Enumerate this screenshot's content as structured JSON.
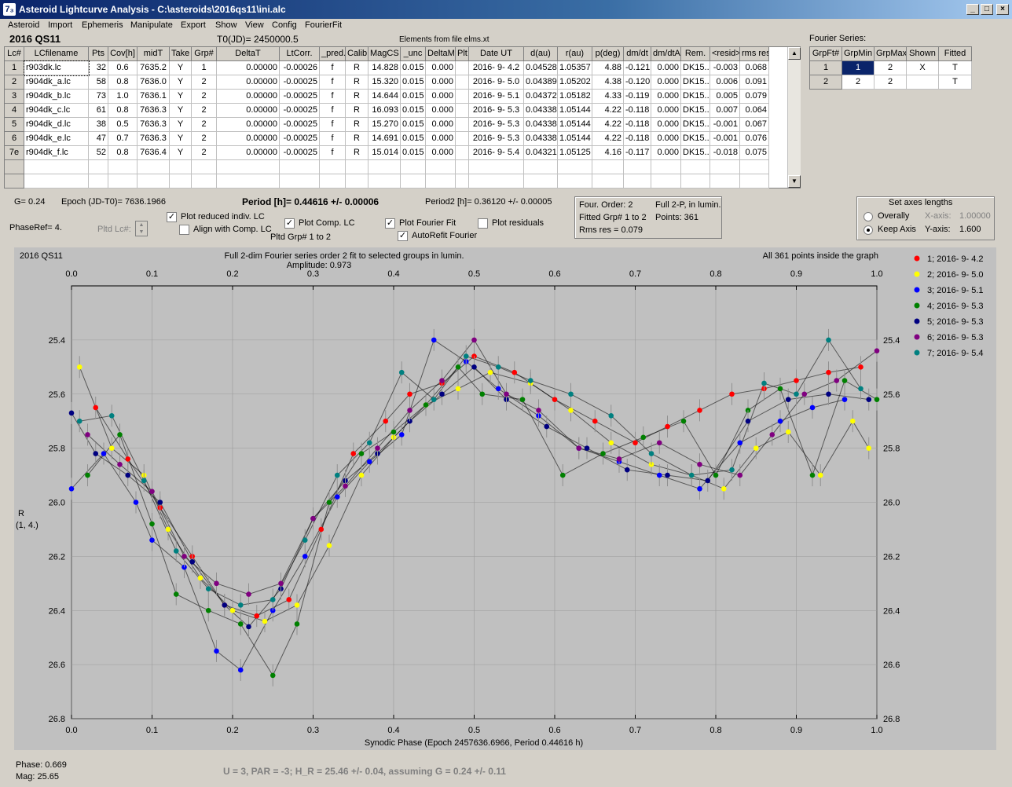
{
  "window": {
    "title": "Asteroid Lightcurve Analysis - C:\\asteroids\\2016qs11\\ini.alc",
    "app_icon": "7₃",
    "min": "_",
    "max": "□",
    "close": "×"
  },
  "menu": [
    "Asteroid",
    "Import",
    "Ephemeris",
    "Manipulate",
    "Export",
    "Show",
    "View",
    "Config",
    "FourierFit"
  ],
  "header": {
    "object": "2016 QS11",
    "t0": "T0(JD)= 2450000.5",
    "elements": "Elements from file elms.xt",
    "fourier_label": "Fourier Series:"
  },
  "lc_table": {
    "columns": [
      "Lc#",
      "LCfilename",
      "Pts",
      "Cov[h]",
      "midT",
      "Take",
      "Grp#",
      "DeltaT",
      "LtCorr.",
      "_pred.",
      "Calib.",
      "MagCS",
      "_unc",
      "DeltaM",
      "Plt",
      "Date UT",
      "d(au)",
      "r(au)",
      "p(deg)",
      "dm/dt",
      "dm/dtA",
      "Rem.",
      "<resid>",
      "rms res"
    ],
    "rows": [
      [
        "1",
        "r903dk.lc",
        "32",
        "0.6",
        "7635.2",
        "Y",
        "1",
        "0.00000",
        "-0.00026",
        "f",
        "R",
        "14.828",
        "0.015",
        "0.000",
        "",
        "2016- 9- 4.2",
        "0.04528",
        "1.05357",
        "4.88",
        "-0.121",
        "0.000",
        "DK15...",
        "-0.003",
        "0.068"
      ],
      [
        "2",
        "r904dk_a.lc",
        "58",
        "0.8",
        "7636.0",
        "Y",
        "2",
        "0.00000",
        "-0.00025",
        "f",
        "R",
        "15.320",
        "0.015",
        "0.000",
        "",
        "2016- 9- 5.0",
        "0.04389",
        "1.05202",
        "4.38",
        "-0.120",
        "0.000",
        "DK15...",
        "0.006",
        "0.091"
      ],
      [
        "3",
        "r904dk_b.lc",
        "73",
        "1.0",
        "7636.1",
        "Y",
        "2",
        "0.00000",
        "-0.00025",
        "f",
        "R",
        "14.644",
        "0.015",
        "0.000",
        "",
        "2016- 9- 5.1",
        "0.04372",
        "1.05182",
        "4.33",
        "-0.119",
        "0.000",
        "DK15...",
        "0.005",
        "0.079"
      ],
      [
        "4",
        "r904dk_c.lc",
        "61",
        "0.8",
        "7636.3",
        "Y",
        "2",
        "0.00000",
        "-0.00025",
        "f",
        "R",
        "16.093",
        "0.015",
        "0.000",
        "",
        "2016- 9- 5.3",
        "0.04338",
        "1.05144",
        "4.22",
        "-0.118",
        "0.000",
        "DK15...",
        "0.007",
        "0.064"
      ],
      [
        "5",
        "r904dk_d.lc",
        "38",
        "0.5",
        "7636.3",
        "Y",
        "2",
        "0.00000",
        "-0.00025",
        "f",
        "R",
        "15.270",
        "0.015",
        "0.000",
        "",
        "2016- 9- 5.3",
        "0.04338",
        "1.05144",
        "4.22",
        "-0.118",
        "0.000",
        "DK15...",
        "-0.001",
        "0.067"
      ],
      [
        "6",
        "r904dk_e.lc",
        "47",
        "0.7",
        "7636.3",
        "Y",
        "2",
        "0.00000",
        "-0.00025",
        "f",
        "R",
        "14.691",
        "0.015",
        "0.000",
        "",
        "2016- 9- 5.3",
        "0.04338",
        "1.05144",
        "4.22",
        "-0.118",
        "0.000",
        "DK15...",
        "-0.001",
        "0.076"
      ],
      [
        "7e",
        "r904dk_f.lc",
        "52",
        "0.8",
        "7636.4",
        "Y",
        "2",
        "0.00000",
        "-0.00025",
        "f",
        "R",
        "15.014",
        "0.015",
        "0.000",
        "",
        "2016- 9- 5.4",
        "0.04321",
        "1.05125",
        "4.16",
        "-0.117",
        "0.000",
        "DK15...",
        "-0.018",
        "0.075"
      ]
    ]
  },
  "fourier_table": {
    "columns": [
      "GrpFt#",
      "GrpMin",
      "GrpMax",
      "Shown",
      "Fitted"
    ],
    "rows": [
      [
        "1",
        "1",
        "2",
        "X",
        "T"
      ],
      [
        "2",
        "2",
        "2",
        "",
        "T"
      ]
    ]
  },
  "info": {
    "g": "G= 0.24",
    "epoch": "Epoch (JD-T0)= 7636.1966",
    "period": "Period [h]= 0.44616 +/- 0.00006",
    "period2": "Period2 [h]= 0.36120 +/- 0.00005",
    "phase_ref": "PhaseRef= 4.",
    "pltd_lc": "Pltd Lc#:",
    "plot_reduced": "Plot reduced indiv. LC",
    "align": "Align with Comp. LC",
    "plot_comp": "Plot Comp. LC",
    "pltd_grp": "Pltd Grp#  1  to  2",
    "plot_fourier": "Plot Fourier Fit",
    "autorefit": "AutoRefit Fourier",
    "plot_residuals": "Plot residuals"
  },
  "fit_box": {
    "order": "Four. Order:  2",
    "full2p": "Full 2-P, in lumin.",
    "fitted": "Fitted Grp# 1 to 2",
    "points": "Points: 361",
    "rms": "Rms res    = 0.079"
  },
  "axes_box": {
    "title": "Set axes lengths",
    "overally": "Overally",
    "keep": "Keep Axis",
    "xaxis_label": "X-axis:",
    "xaxis_val": "1.00000",
    "yaxis_label": "Y-axis:",
    "yaxis_val": "1.600"
  },
  "chart_data": {
    "type": "scatter",
    "title": "Full 2-dim Fourier series order 2 fit to selected groups in lumin.",
    "subtitle": "Amplitude: 0.973",
    "object_label": "2016 QS11",
    "points_note": "All 361 points inside the graph",
    "xlabel": "Synodic Phase (Epoch 2457636.6966, Period 0.44616 h)",
    "ylabel": "R",
    "ylabel2": "(1, 4.)",
    "xlim": [
      0.0,
      1.0
    ],
    "ylim": [
      25.2,
      26.8
    ],
    "y_inverted": true,
    "grid": true,
    "xticks": [
      "0.0",
      "0.1",
      "0.2",
      "0.3",
      "0.4",
      "0.5",
      "0.6",
      "0.7",
      "0.8",
      "0.9",
      "1.0"
    ],
    "yticks": [
      "25.4",
      "25.6",
      "25.8",
      "26.0",
      "26.2",
      "26.4",
      "26.6",
      "26.8"
    ],
    "series": [
      {
        "name": "1; 2016- 9- 4.2",
        "color": "#ff0000",
        "x": [
          0.03,
          0.07,
          0.11,
          0.15,
          0.19,
          0.23,
          0.27,
          0.31,
          0.35,
          0.39,
          0.42,
          0.46,
          0.5,
          0.55,
          0.6,
          0.65,
          0.7,
          0.74,
          0.78,
          0.82,
          0.86,
          0.9,
          0.94,
          0.98
        ],
        "y": [
          25.65,
          25.84,
          26.02,
          26.2,
          26.38,
          26.42,
          26.36,
          26.1,
          25.82,
          25.7,
          25.6,
          25.56,
          25.46,
          25.52,
          25.62,
          25.7,
          25.78,
          25.72,
          25.66,
          25.6,
          25.58,
          25.55,
          25.52,
          25.5
        ]
      },
      {
        "name": "2; 2016- 9- 5.0",
        "color": "#ffff00",
        "x": [
          0.01,
          0.05,
          0.09,
          0.12,
          0.16,
          0.2,
          0.24,
          0.28,
          0.32,
          0.36,
          0.4,
          0.44,
          0.48,
          0.52,
          0.57,
          0.62,
          0.67,
          0.72,
          0.77,
          0.81,
          0.85,
          0.89,
          0.93,
          0.97,
          0.99
        ],
        "y": [
          25.5,
          25.8,
          25.9,
          26.1,
          26.28,
          26.4,
          26.44,
          26.38,
          26.16,
          25.9,
          25.76,
          25.64,
          25.58,
          25.52,
          25.56,
          25.66,
          25.78,
          25.86,
          25.9,
          25.95,
          25.8,
          25.74,
          25.9,
          25.7,
          25.8
        ]
      },
      {
        "name": "3; 2016- 9- 5.1",
        "color": "#0000ff",
        "x": [
          0.0,
          0.04,
          0.08,
          0.1,
          0.14,
          0.18,
          0.21,
          0.25,
          0.29,
          0.33,
          0.37,
          0.41,
          0.45,
          0.49,
          0.53,
          0.58,
          0.63,
          0.68,
          0.73,
          0.78,
          0.83,
          0.88,
          0.92,
          0.96
        ],
        "y": [
          25.95,
          25.82,
          26.0,
          26.14,
          26.24,
          26.55,
          26.62,
          26.4,
          26.2,
          25.98,
          25.85,
          25.75,
          25.4,
          25.48,
          25.58,
          25.68,
          25.8,
          25.85,
          25.9,
          25.95,
          25.78,
          25.7,
          25.65,
          25.62
        ]
      },
      {
        "name": "4; 2016- 9- 5.3",
        "color": "#008000",
        "x": [
          0.02,
          0.06,
          0.1,
          0.13,
          0.17,
          0.21,
          0.25,
          0.28,
          0.32,
          0.36,
          0.4,
          0.44,
          0.48,
          0.51,
          0.56,
          0.61,
          0.66,
          0.71,
          0.76,
          0.8,
          0.84,
          0.88,
          0.92,
          0.96,
          1.0
        ],
        "y": [
          25.9,
          25.75,
          26.08,
          26.34,
          26.4,
          26.45,
          26.64,
          26.45,
          26.0,
          25.82,
          25.74,
          25.64,
          25.5,
          25.6,
          25.62,
          25.9,
          25.82,
          25.76,
          25.7,
          25.9,
          25.66,
          25.58,
          25.9,
          25.55,
          25.62
        ]
      },
      {
        "name": "5; 2016- 9- 5.3",
        "color": "#000080",
        "x": [
          0.0,
          0.03,
          0.07,
          0.11,
          0.15,
          0.19,
          0.22,
          0.26,
          0.3,
          0.34,
          0.38,
          0.42,
          0.46,
          0.5,
          0.54,
          0.59,
          0.64,
          0.69,
          0.74,
          0.79,
          0.84,
          0.89,
          0.94,
          0.99
        ],
        "y": [
          25.67,
          25.82,
          25.9,
          26.0,
          26.22,
          26.38,
          26.46,
          26.32,
          26.06,
          25.92,
          25.82,
          25.7,
          25.6,
          25.5,
          25.62,
          25.72,
          25.8,
          25.88,
          25.9,
          25.92,
          25.7,
          25.62,
          25.6,
          25.62
        ]
      },
      {
        "name": "6; 2016- 9- 5.3",
        "color": "#800080",
        "x": [
          0.02,
          0.06,
          0.1,
          0.14,
          0.18,
          0.22,
          0.26,
          0.3,
          0.34,
          0.38,
          0.42,
          0.46,
          0.5,
          0.54,
          0.58,
          0.63,
          0.68,
          0.73,
          0.78,
          0.83,
          0.87,
          0.91,
          0.95,
          1.0
        ],
        "y": [
          25.75,
          25.86,
          25.96,
          26.2,
          26.3,
          26.34,
          26.3,
          26.06,
          25.94,
          25.8,
          25.66,
          25.55,
          25.4,
          25.6,
          25.66,
          25.8,
          25.84,
          25.78,
          25.86,
          25.9,
          25.75,
          25.6,
          25.55,
          25.44
        ]
      },
      {
        "name": "7; 2016- 9- 5.4",
        "color": "#008080",
        "x": [
          0.01,
          0.05,
          0.09,
          0.13,
          0.17,
          0.21,
          0.25,
          0.29,
          0.33,
          0.37,
          0.41,
          0.45,
          0.49,
          0.53,
          0.57,
          0.62,
          0.67,
          0.72,
          0.77,
          0.82,
          0.86,
          0.9,
          0.94,
          0.98
        ],
        "y": [
          25.7,
          25.68,
          25.92,
          26.18,
          26.32,
          26.38,
          26.36,
          26.14,
          25.9,
          25.78,
          25.52,
          25.62,
          25.46,
          25.5,
          25.55,
          25.6,
          25.68,
          25.82,
          25.9,
          25.88,
          25.56,
          25.6,
          25.4,
          25.58
        ]
      }
    ]
  },
  "status": {
    "phase": "Phase:  0.669",
    "mag": "Mag:    25.65",
    "summary": "U = 3, PAR = -3; H_R = 25.46 +/- 0.04, assuming G = 0.24 +/- 0.11"
  }
}
